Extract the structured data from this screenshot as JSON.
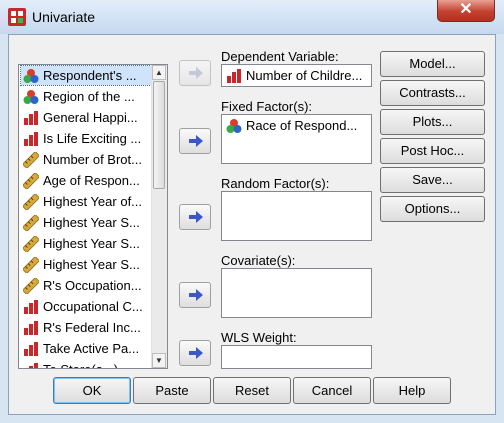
{
  "window": {
    "title": "Univariate",
    "close_glyph": "✕"
  },
  "variables": [
    {
      "label": "Respondent's ...",
      "icon": "nominal-icon",
      "selected": true
    },
    {
      "label": "Region of the ...",
      "icon": "nominal-icon"
    },
    {
      "label": "General Happi...",
      "icon": "ordinal-icon"
    },
    {
      "label": "Is Life Exciting ...",
      "icon": "ordinal-icon"
    },
    {
      "label": "Number of Brot...",
      "icon": "scale-icon"
    },
    {
      "label": "Age of Respon...",
      "icon": "scale-icon"
    },
    {
      "label": "Highest Year of...",
      "icon": "scale-icon"
    },
    {
      "label": "Highest Year S...",
      "icon": "scale-icon"
    },
    {
      "label": "Highest Year S...",
      "icon": "scale-icon"
    },
    {
      "label": "Highest Year S...",
      "icon": "scale-icon"
    },
    {
      "label": "R's Occupation...",
      "icon": "scale-icon"
    },
    {
      "label": "Occupational C...",
      "icon": "ordinal-icon"
    },
    {
      "label": "R's Federal Inc...",
      "icon": "ordinal-icon"
    },
    {
      "label": "Take Active Pa...",
      "icon": "ordinal-icon"
    },
    {
      "label": "To Store(a...)",
      "icon": "ordinal-icon"
    }
  ],
  "fields": {
    "dependent": {
      "label": "Dependent Variable:",
      "value": "Number of Childre..."
    },
    "fixed": {
      "label": "Fixed Factor(s):",
      "value": "Race of Respond..."
    },
    "random": {
      "label": "Random Factor(s):"
    },
    "covariate": {
      "label": "Covariate(s):"
    },
    "wls": {
      "label": "WLS Weight:"
    }
  },
  "side_buttons": [
    "Model...",
    "Contrasts...",
    "Plots...",
    "Post Hoc...",
    "Save...",
    "Options..."
  ],
  "bottom_buttons": [
    "OK",
    "Paste",
    "Reset",
    "Cancel",
    "Help"
  ],
  "colors": {
    "nominal_red": "#d93c2b",
    "nominal_green": "#3aa845",
    "nominal_blue": "#2e64c8",
    "ordinal_bar": "#c8282a",
    "scale_ruler": "#d8a93a",
    "arrow_blue": "#3a58c8"
  }
}
